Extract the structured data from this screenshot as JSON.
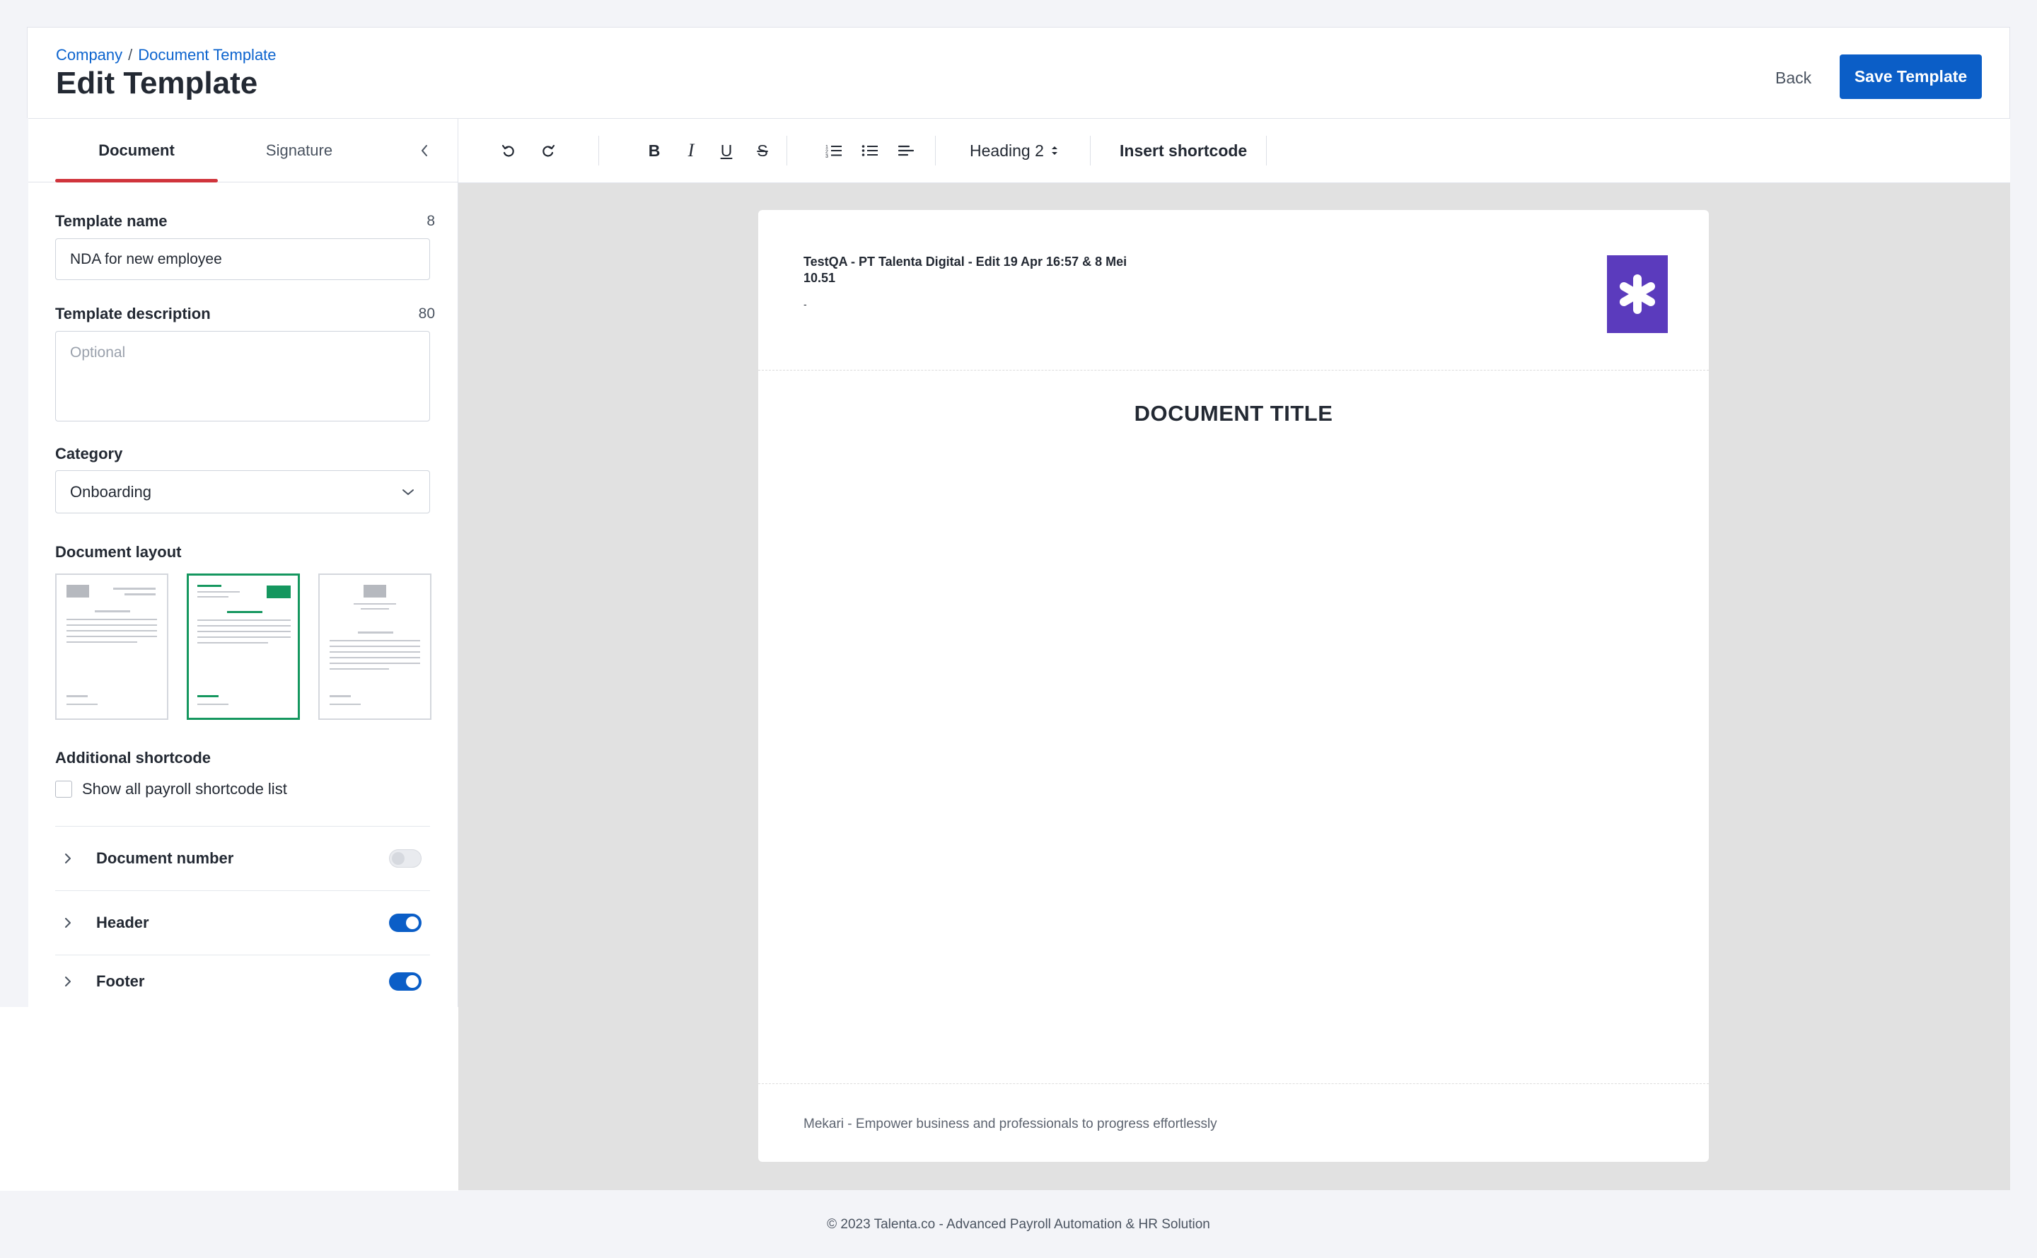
{
  "header": {
    "breadcrumb": [
      "Company",
      "Document Template"
    ],
    "breadcrumb_sep": "/",
    "title": "Edit Template",
    "back_label": "Back",
    "save_label": "Save Template"
  },
  "panel": {
    "tabs": [
      {
        "label": "Document",
        "active": true
      },
      {
        "label": "Signature",
        "active": false
      }
    ],
    "template_name": {
      "label": "Template name",
      "count": "8",
      "value": "NDA for new employee"
    },
    "template_description": {
      "label": "Template description",
      "count": "80",
      "placeholder": "Optional",
      "value": ""
    },
    "category": {
      "label": "Category",
      "value": "Onboarding"
    },
    "document_layout": {
      "label": "Document layout",
      "selected_index": 1
    },
    "additional_shortcode": {
      "label": "Additional shortcode",
      "checkbox_label": "Show all payroll shortcode list",
      "checked": false
    },
    "sections": [
      {
        "label": "Document number",
        "enabled": false
      },
      {
        "label": "Header",
        "enabled": true
      },
      {
        "label": "Footer",
        "enabled": true
      }
    ]
  },
  "toolbar": {
    "heading_label": "Heading 2",
    "insert_shortcode_label": "Insert shortcode",
    "bold": "B",
    "italic": "I",
    "underline": "U",
    "strike": "S"
  },
  "document": {
    "header_text": "TestQA - PT Talenta Digital - Edit 19 Apr 16:57 & 8 Mei 10.51",
    "header_sub": "-",
    "title": "DOCUMENT TITLE",
    "footer_text": "Mekari - Empower business and professionals to progress effortlessly",
    "logo_color": "#5b3bbd"
  },
  "footer": {
    "text": "© 2023 Talenta.co - Advanced Payroll Automation & HR Solution"
  },
  "colors": {
    "primary": "#0b5ec7",
    "tab_indicator": "#d0343c",
    "layout_selected": "#15975f"
  }
}
